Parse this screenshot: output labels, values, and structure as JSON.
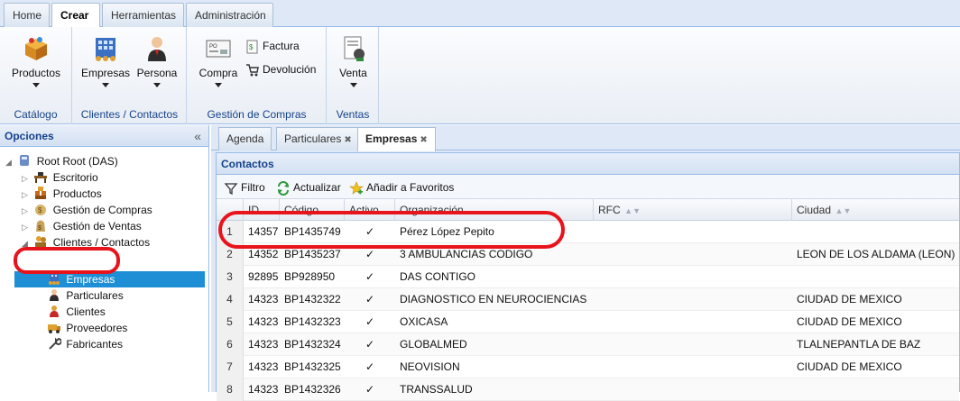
{
  "top_tabs": [
    "Home",
    "Crear",
    "Herramientas",
    "Administración"
  ],
  "active_top_tab": "Crear",
  "ribbon": {
    "groups": [
      {
        "label": "Catálogo"
      },
      {
        "label": "Clientes / Contactos"
      },
      {
        "label": "Gestión de Compras"
      },
      {
        "label": "Ventas"
      }
    ],
    "buttons": {
      "productos": "Productos",
      "empresas": "Empresas",
      "persona": "Persona",
      "compra": "Compra",
      "factura": "Factura",
      "devolucion": "Devolución",
      "venta": "Venta"
    }
  },
  "left_panel": {
    "title": "Opciones",
    "collapse_glyph": "«",
    "tree": [
      {
        "label": "Root Root (DAS)",
        "icon": "root-icon"
      },
      {
        "label": "Escritorio",
        "icon": "desk-icon"
      },
      {
        "label": "Productos",
        "icon": "products-icon"
      },
      {
        "label": "Gestión de Compras",
        "icon": "purchases-icon"
      },
      {
        "label": "Gestión de Ventas",
        "icon": "sales-icon"
      },
      {
        "label": "Clientes / Contactos",
        "icon": "contacts-icon"
      },
      {
        "label": "Empresas",
        "icon": "company-icon",
        "selected": true
      },
      {
        "label": "Particulares",
        "icon": "person-icon"
      },
      {
        "label": "Clientes",
        "icon": "client-icon"
      },
      {
        "label": "Proveedores",
        "icon": "supplier-icon"
      },
      {
        "label": "Fabricantes",
        "icon": "wrench-icon"
      }
    ]
  },
  "content_tabs": [
    {
      "label": "Agenda",
      "closable": false
    },
    {
      "label": "Particulares",
      "closable": true
    },
    {
      "label": "Empresas",
      "closable": true,
      "active": true
    }
  ],
  "panel": {
    "title": "Contactos",
    "toolbar": {
      "filter": "Filtro",
      "refresh": "Actualizar",
      "favorites": "Añadir a Favoritos"
    }
  },
  "grid": {
    "columns": [
      "ID",
      "Código",
      "Activo",
      "Organización",
      "RFC",
      "Ciudad"
    ],
    "rows": [
      {
        "n": "1",
        "id": "14357",
        "code": "BP1435749",
        "active": "✓",
        "org": "Pérez López Pepito",
        "rfc": "",
        "city": ""
      },
      {
        "n": "2",
        "id": "14352",
        "code": "BP1435237",
        "active": "✓",
        "org": "3 AMBULANCIAS CODIGO",
        "rfc": "",
        "city": "LEON DE LOS ALDAMA (LEON)"
      },
      {
        "n": "3",
        "id": "92895",
        "code": "BP928950",
        "active": "✓",
        "org": "DAS CONTIGO",
        "rfc": "",
        "city": ""
      },
      {
        "n": "4",
        "id": "14323",
        "code": "BP1432322",
        "active": "✓",
        "org": "DIAGNOSTICO EN NEUROCIENCIAS",
        "rfc": "",
        "city": "CIUDAD DE MEXICO"
      },
      {
        "n": "5",
        "id": "14323",
        "code": "BP1432323",
        "active": "✓",
        "org": "OXICASA",
        "rfc": "",
        "city": "CIUDAD DE MEXICO"
      },
      {
        "n": "6",
        "id": "14323",
        "code": "BP1432324",
        "active": "✓",
        "org": "GLOBALMED",
        "rfc": "",
        "city": "TLALNEPANTLA DE BAZ"
      },
      {
        "n": "7",
        "id": "14323",
        "code": "BP1432325",
        "active": "✓",
        "org": "NEOVISION",
        "rfc": "",
        "city": "CIUDAD DE MEXICO"
      },
      {
        "n": "8",
        "id": "14323",
        "code": "BP1432326",
        "active": "✓",
        "org": "TRANSSALUD",
        "rfc": "",
        "city": ""
      }
    ]
  },
  "colors": {
    "accent": "#15428b",
    "selection": "#1e8fd5",
    "annotation": "#e8141b"
  }
}
